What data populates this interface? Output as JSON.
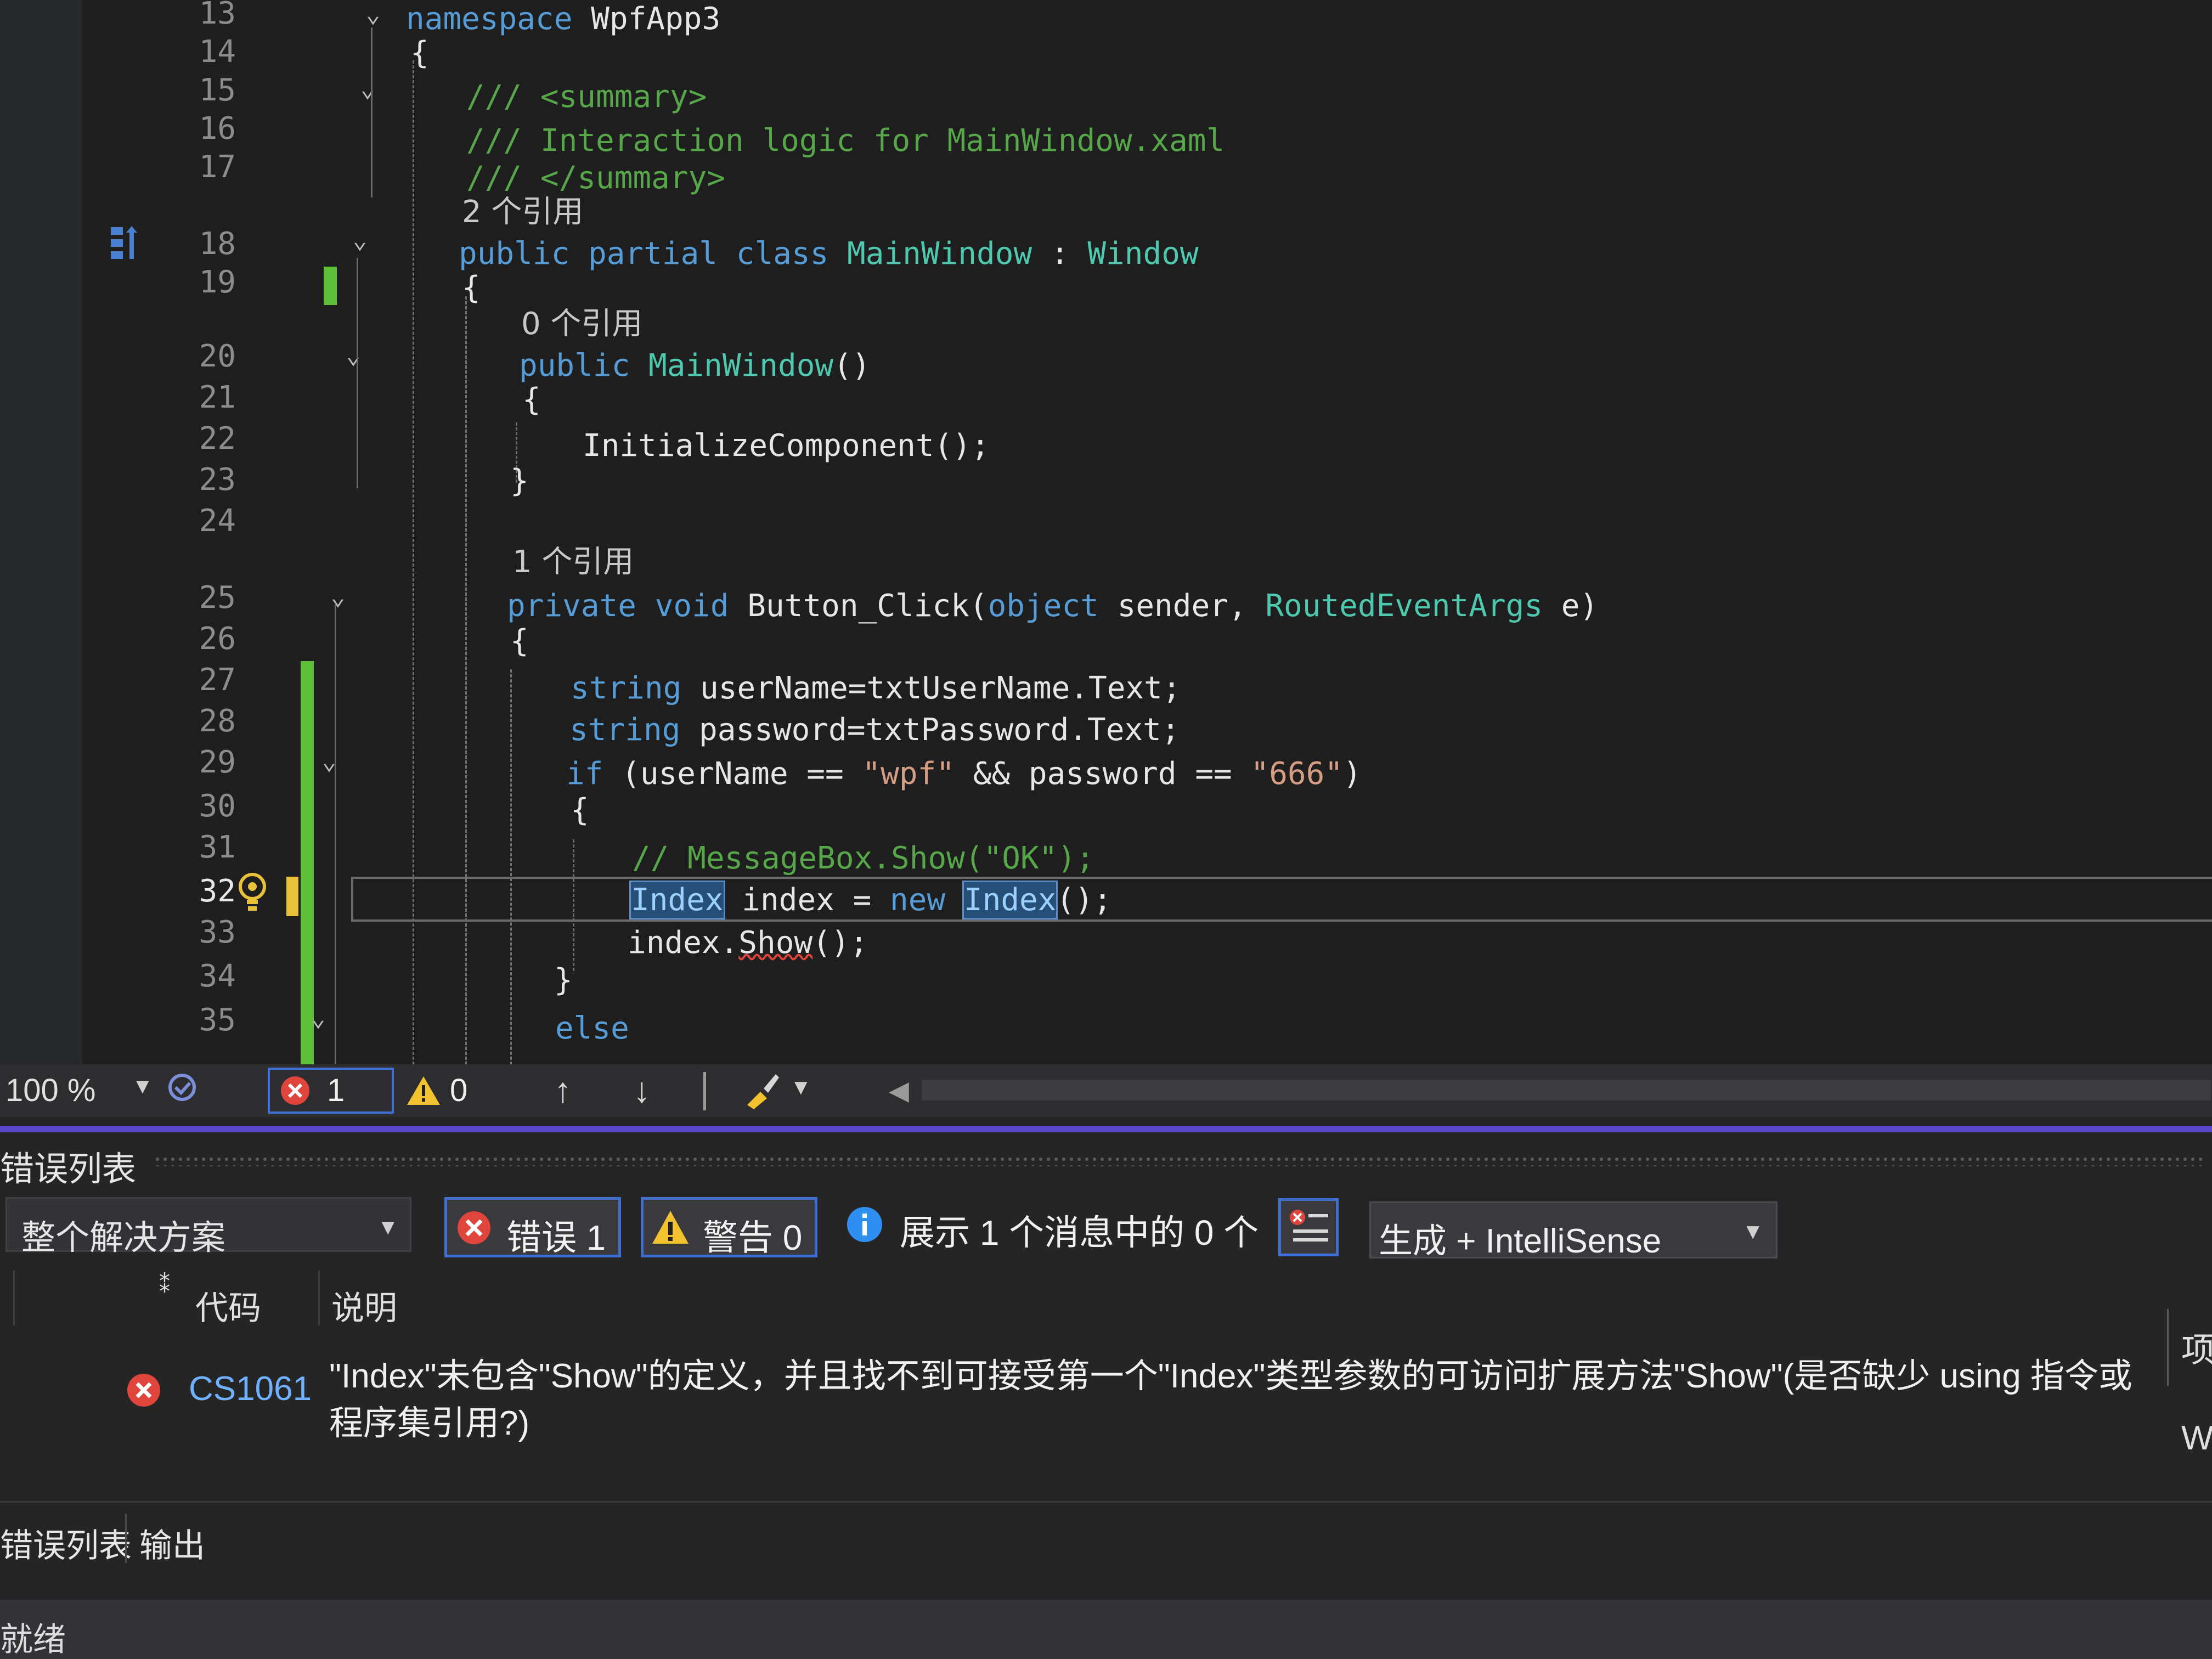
{
  "editor": {
    "line_numbers": [
      "13",
      "14",
      "15",
      "16",
      "17",
      "18",
      "19",
      "20",
      "21",
      "22",
      "23",
      "24",
      "25",
      "26",
      "27",
      "28",
      "29",
      "30",
      "31",
      "32",
      "33",
      "34",
      "35"
    ],
    "current_line": "32",
    "references": {
      "class_refs": "2 个引用",
      "ctor_refs": "0 个引用",
      "method_refs": "1 个引用"
    },
    "code": {
      "l13_kw": "namespace",
      "l13_name": "WpfApp3",
      "l14": "{",
      "l15": "/// <summary>",
      "l16": "/// Interaction logic for MainWindow.xaml",
      "l17": "/// </summary>",
      "l18_kw": "public partial class",
      "l18_name": "MainWindow",
      "l18_colon": ":",
      "l18_base": "Window",
      "l19": "{",
      "l20_kw": "public",
      "l20_name": "MainWindow",
      "l20_parens": "()",
      "l21": "{",
      "l22": "InitializeComponent();",
      "l23": "}",
      "l25_kw": "private void",
      "l25_name": "Button_Click(",
      "l25_kw2": "object",
      "l25_arg1": "sender,",
      "l25_type": "RoutedEventArgs",
      "l25_arg2": "e)",
      "l26": "{",
      "l27_kw": "string",
      "l27_rest": "userName=txtUserName.Text;",
      "l28_kw": "string",
      "l28_rest": "password=txtPassword.Text;",
      "l29_kw": "if",
      "l29_a": "(userName ==",
      "l29_s1": "\"wpf\"",
      "l29_b": "&& password ==",
      "l29_s2": "\"666\"",
      "l29_c": ")",
      "l30": "{",
      "l31": "// MessageBox.Show(\"OK\");",
      "l32_type": "Index",
      "l32_var": "index =",
      "l32_new": "new",
      "l32_type2": "Index",
      "l32_end": "();",
      "l33_a": "index.",
      "l33_method": "Show",
      "l33_end": "();",
      "l34": "}",
      "l35": "else"
    }
  },
  "strip": {
    "zoom": "100 %",
    "error_count": "1",
    "warning_count": "0"
  },
  "error_list": {
    "title": "错误列表",
    "scope": "整个解决方案",
    "errors_btn": "错误 1",
    "warnings_btn": "警告 0",
    "messages": "展示 1 个消息中的 0 个",
    "source": "生成 + IntelliSense",
    "col_code": "代码",
    "col_desc": "说明",
    "col_project_partial": "项",
    "rows": [
      {
        "code": "CS1061",
        "description": "\"Index\"未包含\"Show\"的定义，并且找不到可接受第一个\"Index\"类型参数的可访问扩展方法\"Show\"(是否缺少 using 指令或程序集引用?)",
        "file_partial": "W"
      }
    ]
  },
  "bottom_tabs": [
    "错误列表",
    "输出"
  ],
  "status": {
    "text": "就绪"
  },
  "colors": {
    "keyword": "#569cd6",
    "type": "#4ec9b0",
    "string": "#d69d85",
    "comment": "#57a64a",
    "change_marker": "#5fbf3b",
    "accent": "#5b48c8",
    "error": "#e0453b"
  }
}
